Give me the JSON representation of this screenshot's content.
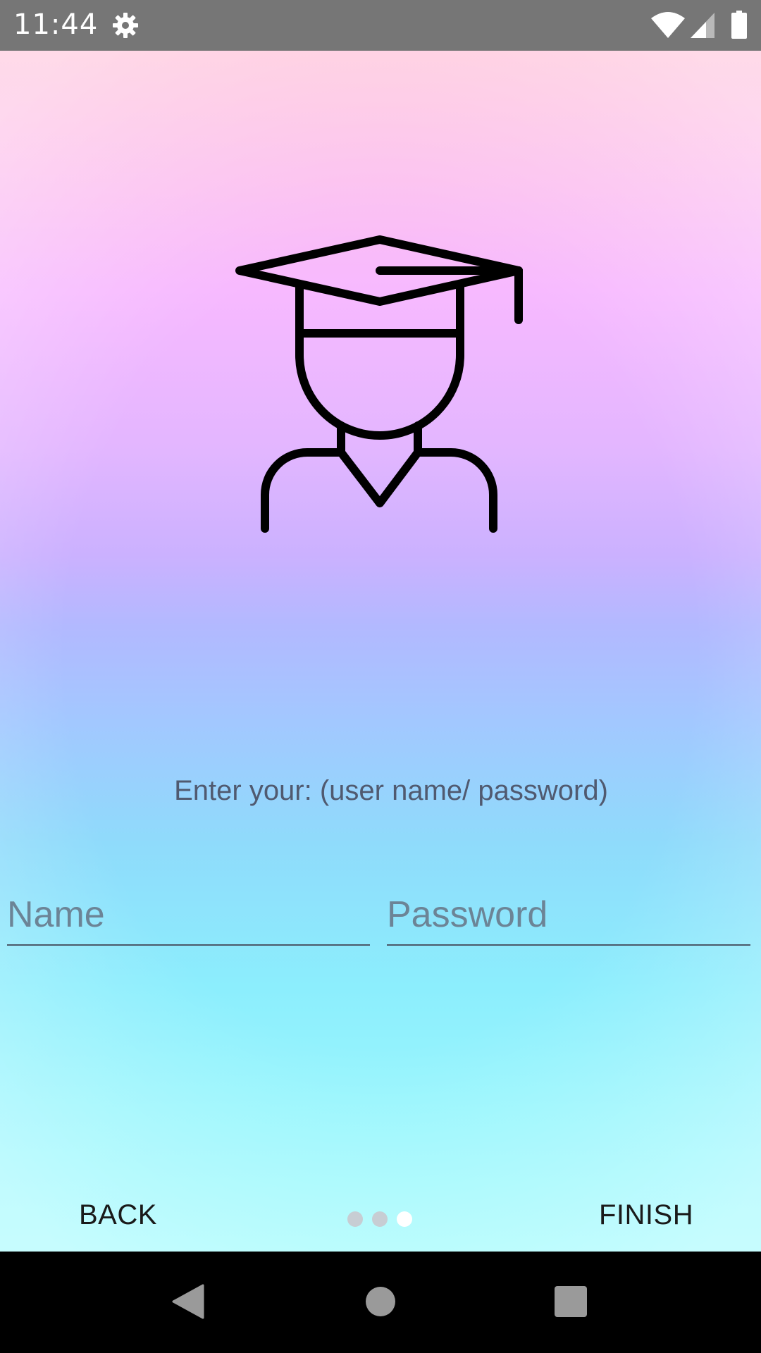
{
  "status_bar": {
    "time": "11:44",
    "icons": [
      "gear-icon",
      "wifi-icon",
      "signal-icon",
      "battery-icon"
    ]
  },
  "illustration": {
    "icon": "graduate-icon"
  },
  "form": {
    "prompt": "Enter your: (user name/ password)",
    "name_placeholder": "Name",
    "password_placeholder": "Password"
  },
  "pager": {
    "back_label": "BACK",
    "finish_label": "FINISH",
    "page_count": 3,
    "current_page": 3
  },
  "nav_bar": {
    "icons": [
      "back-triangle-icon",
      "home-circle-icon",
      "recents-square-icon"
    ]
  },
  "colors": {
    "status_bar": "#767676",
    "gradient_top": "#ffc6dc",
    "gradient_middle": "#cbb1ff",
    "gradient_bottom": "#a8fbfd",
    "dot_active": "#ffffff",
    "dot_inactive": "#c7cdd3"
  }
}
